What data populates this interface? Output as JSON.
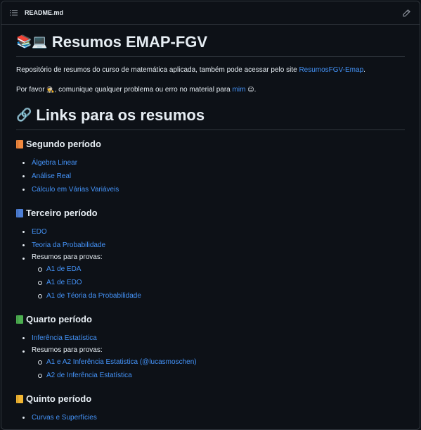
{
  "header": {
    "filename": "README.md",
    "toc_icon": "list-unordered-icon",
    "edit_icon": "pencil-icon"
  },
  "title": {
    "emoji": "📚💻",
    "text": "Resumos EMAP-FGV"
  },
  "intro": {
    "text": "Repositório de resumos do curso de matemática aplicada, também pode acessar pelo site ",
    "link": "ResumosFGV-Emap",
    "after": "."
  },
  "report": {
    "before": "Por favor ",
    "emoji1": "🕵️",
    "middle": ", comunique qualquer problema ou erro no material para ",
    "link": "mim",
    "emoji2": "😉",
    "after": "."
  },
  "links_heading": {
    "emoji": "🔗",
    "text": "Links para os resumos"
  },
  "periods": [
    {
      "title": "Segundo período",
      "book_color": "#f0883e",
      "items": [
        "Álgebra Linear",
        "Análise Real",
        "Cálculo em Várias Variáveis"
      ]
    },
    {
      "title": "Terceiro período",
      "book_color": "#4d7fd6",
      "items": [
        "EDO",
        "Teoria da Probabilidade"
      ],
      "exams_label": "Resumos para provas:",
      "exams": [
        "A1 de EDA",
        "A1 de EDO",
        "A1 de Téoria da Probabilidade"
      ]
    },
    {
      "title": "Quarto período",
      "book_color": "#4caf50",
      "items": [
        "Inferência Estatística"
      ],
      "exams_label": "Resumos para provas:",
      "exams": [
        "A1 e A2 Inferência Estatistica (@lucasmoschen)",
        "A2 de Inferência Estatística"
      ]
    },
    {
      "title": "Quinto período",
      "book_color": "#f2b632",
      "items": [
        "Curvas e Superfícies"
      ]
    }
  ]
}
